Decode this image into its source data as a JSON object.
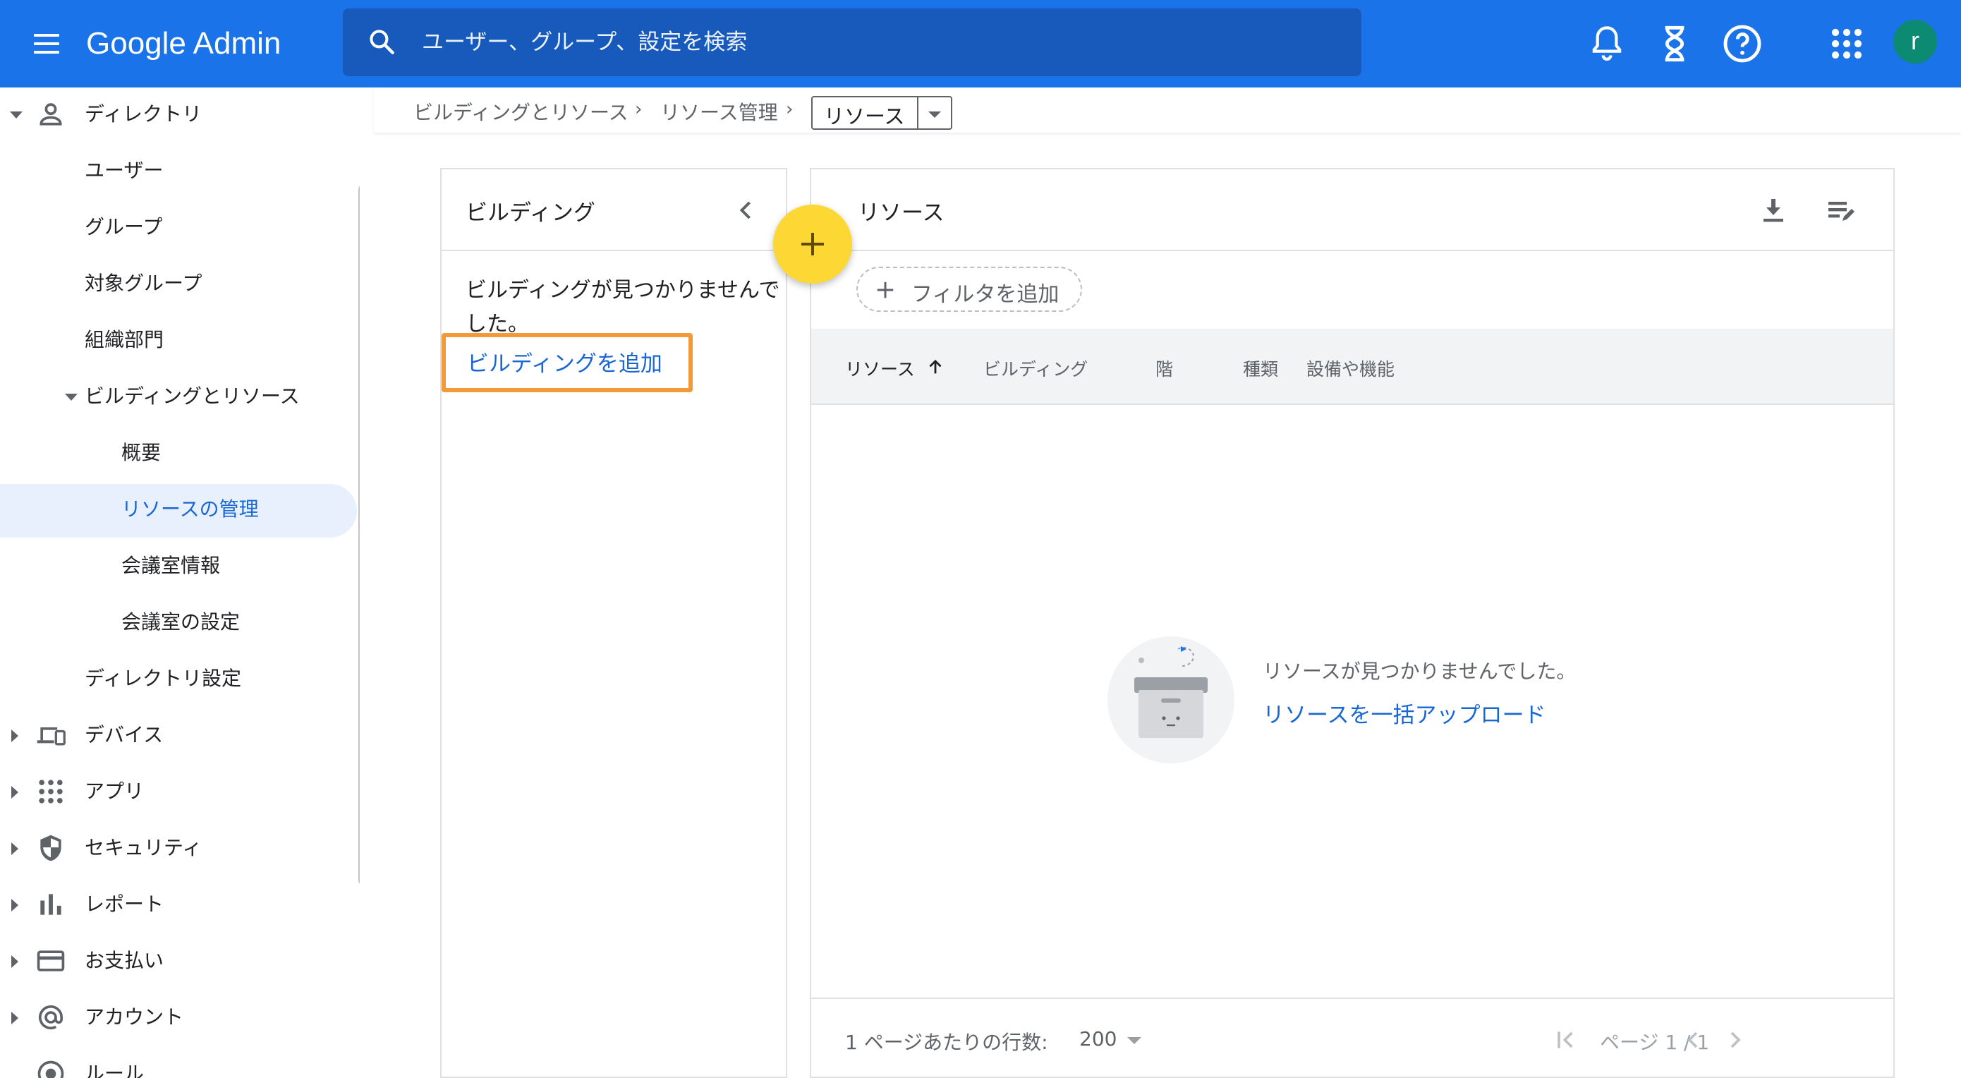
{
  "app": {
    "title": "Google Admin"
  },
  "search": {
    "placeholder": "ユーザー、グループ、設定を検索"
  },
  "topbar": {
    "icons": [
      "bell-icon",
      "hourglass-icon",
      "help-icon",
      "apps-grid-icon"
    ],
    "avatar_letter": "r",
    "avatar_color": "#0d8a72",
    "bar_color": "#1a73e8"
  },
  "sidebar": {
    "items": [
      {
        "label": "ディレクトリ",
        "icon": "person-icon",
        "expanded": true
      },
      {
        "label": "ユーザー"
      },
      {
        "label": "グループ"
      },
      {
        "label": "対象グループ"
      },
      {
        "label": "組織部門"
      },
      {
        "label": "ビルディングとリソース",
        "expanded": true
      },
      {
        "label": "概要"
      },
      {
        "label": "リソースの管理",
        "active": true
      },
      {
        "label": "会議室情報"
      },
      {
        "label": "会議室の設定"
      },
      {
        "label": "ディレクトリ設定"
      },
      {
        "label": "デバイス",
        "icon": "devices-icon"
      },
      {
        "label": "アプリ",
        "icon": "apps-icon"
      },
      {
        "label": "セキュリティ",
        "icon": "shield-icon"
      },
      {
        "label": "レポート",
        "icon": "bar-chart-icon"
      },
      {
        "label": "お支払い",
        "icon": "credit-card-icon"
      },
      {
        "label": "アカウント",
        "icon": "at-sign-icon"
      },
      {
        "label": "ルール",
        "icon": "rules-icon"
      }
    ]
  },
  "breadcrumb": {
    "items": [
      "ビルディングとリソース",
      "リソース管理"
    ],
    "current": "リソース"
  },
  "buildings": {
    "title": "ビルディング",
    "empty_text": "ビルディングが見つかりませんでした。",
    "add_link": "ビルディングを追加",
    "highlight_color": "#f29a38"
  },
  "resources": {
    "title": "リソース",
    "filter_label": "フィルタを追加",
    "columns": [
      "リソース",
      "ビルディング",
      "階",
      "種類",
      "設備や機能"
    ],
    "empty_text": "リソースが見つかりませんでした。",
    "bulk_upload_link": "リソースを一括アップロード"
  },
  "pagination": {
    "rows_label": "1 ページあたりの行数:",
    "rows_value": "200",
    "page_label": "ページ 1 / 1"
  },
  "fab": {
    "color": "#fdd835",
    "icon": "plus-icon"
  }
}
